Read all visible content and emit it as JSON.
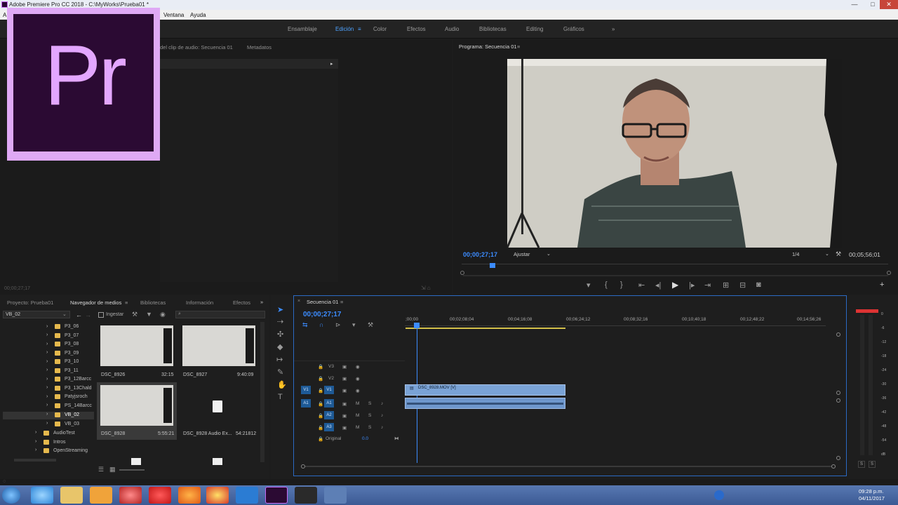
{
  "window": {
    "title": "Adobe Premiere Pro CC 2018 - C:\\MyWorks\\Prueba01 *",
    "minimize": "—",
    "maximize": "□",
    "close": "✕"
  },
  "menu": {
    "items": [
      "A",
      "Ventana",
      "Ayuda"
    ]
  },
  "workspaces": {
    "items": [
      "Ensamblaje",
      "Edición",
      "Color",
      "Efectos",
      "Audio",
      "Bibliotecas",
      "Editing",
      "Gráficos"
    ],
    "active": "Edición",
    "more": "»"
  },
  "logo": {
    "text": "Pr"
  },
  "source": {
    "tab_audio": "del clip de audio: Secuencia 01",
    "tab_meta": "Metadatos",
    "timecode": "00;00;27;17"
  },
  "program": {
    "tab": "Programa: Secuencia 01",
    "timecode": "00;00;27;17",
    "fit": "Ajustar",
    "resolution": "1/4",
    "duration": "00;05;56;01"
  },
  "project": {
    "tabs": [
      "Proyecto: Prueba01",
      "Navegador de medios",
      "Bibliotecas",
      "Información",
      "Efectos"
    ],
    "active_tab": "Navegador de medios",
    "path": "VB_02",
    "ingest": "Ingestar",
    "folders": [
      "P3_06",
      "P3_07",
      "P3_08",
      "P3_09",
      "P3_10",
      "P3_11",
      "P3_12Barcc",
      "P3_13Chald",
      "Patyjsroch",
      "PS_14Barcc",
      "VB_02",
      "VB_03",
      "AudioTest",
      "Intros",
      "OpenStreaming"
    ],
    "selected_folder": "VB_02",
    "media": [
      {
        "name": "DSC_8926",
        "duration": "32:15"
      },
      {
        "name": "DSC_8927",
        "duration": "9:40:09"
      },
      {
        "name": "DSC_8928",
        "duration": "5:55:21"
      },
      {
        "name": "DSC_8928 Audio Ex...",
        "duration": "54:21812"
      }
    ]
  },
  "timeline": {
    "tab": "Secuencia 01",
    "timecode": "00;00;27;17",
    "ruler": [
      ";00;00",
      "00;02;08;04",
      "00;04;16;08",
      "00;06;24;12",
      "00;08;32;16",
      "00;10;40;18",
      "00;12;48;22",
      "00;14;56;26"
    ],
    "video_tracks": [
      "V3",
      "V2",
      "V1"
    ],
    "audio_tracks": [
      "A1",
      "A2",
      "A3"
    ],
    "source_v": "V1",
    "source_a": "A1",
    "master_label": "Original",
    "master_value": "0.0",
    "m": "M",
    "s": "S",
    "video_clip": "DSC_8928.MOV [V]"
  },
  "meter": {
    "labels": [
      "0",
      "-6",
      "-12",
      "-18",
      "-24",
      "-30",
      "-36",
      "-42",
      "-48",
      "-54",
      "dB"
    ],
    "solo": "S"
  },
  "taskbar": {
    "time": "09:28 p.m.",
    "date": "04/11/2017"
  }
}
